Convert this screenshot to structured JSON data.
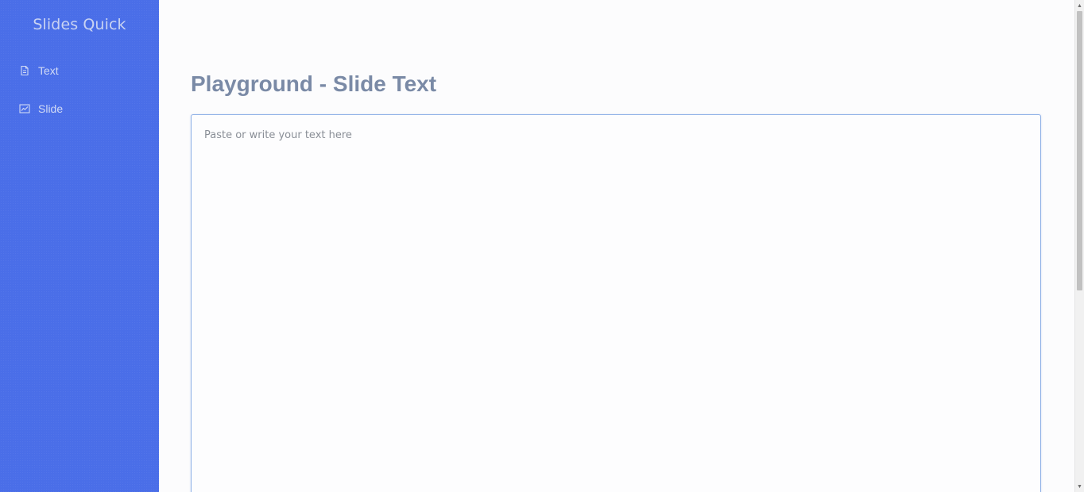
{
  "app": {
    "brand": "Slides Quick"
  },
  "sidebar": {
    "items": [
      {
        "label": "Text",
        "icon": "document-icon"
      },
      {
        "label": "Slide",
        "icon": "chart-line-icon"
      }
    ]
  },
  "main": {
    "title": "Playground - Slide Text",
    "editor": {
      "value": "",
      "placeholder": "Paste or write your text here"
    }
  },
  "colors": {
    "sidebar_bg": "#4a6ee8",
    "title": "#7a8aa6",
    "editor_border": "#8eb0e6"
  },
  "scrollbar": {
    "up_glyph": "▲",
    "down_glyph": "▼"
  }
}
